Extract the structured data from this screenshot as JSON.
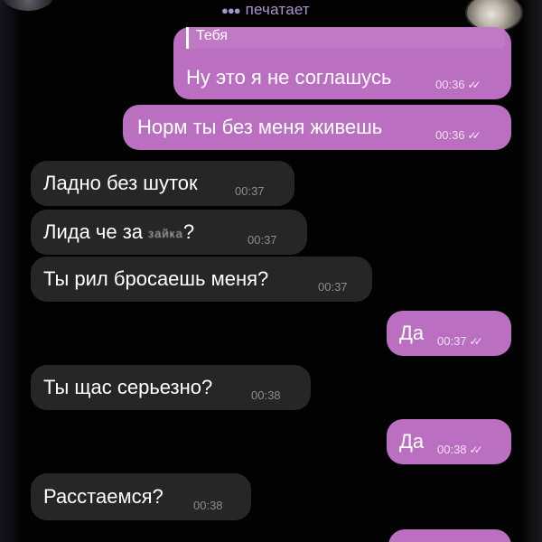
{
  "header": {
    "typing_status": "печатает"
  },
  "messages": [
    {
      "direction": "out",
      "reply_to": "Тебя",
      "text": "Ну это я не соглашусь",
      "time": "00:36",
      "read": true
    },
    {
      "direction": "out",
      "text": "Норм ты без меня живешь",
      "time": "00:36",
      "read": true
    },
    {
      "direction": "in",
      "text": "Ладно без шуток",
      "time": "00:37"
    },
    {
      "direction": "in",
      "text_before": "Лида че за ",
      "censored": "зайка",
      "text_after": "?",
      "time": "00:37"
    },
    {
      "direction": "in",
      "text": "Ты рил бросаешь меня?",
      "time": "00:37"
    },
    {
      "direction": "out",
      "text": "Да",
      "time": "00:37",
      "read": true
    },
    {
      "direction": "in",
      "text": "Ты щас серьезно?",
      "time": "00:38"
    },
    {
      "direction": "out",
      "text": "Да",
      "time": "00:38",
      "read": true
    },
    {
      "direction": "in",
      "text": "Расстаемся?",
      "time": "00:38"
    }
  ],
  "colors": {
    "outgoing_bubble": "#bb6fc1",
    "incoming_bubble": "#262626",
    "background": "#020203",
    "typing_text": "#a993c9"
  },
  "icons": {
    "read_receipt": "double-check-icon",
    "typing": "typing-dots-icon"
  }
}
